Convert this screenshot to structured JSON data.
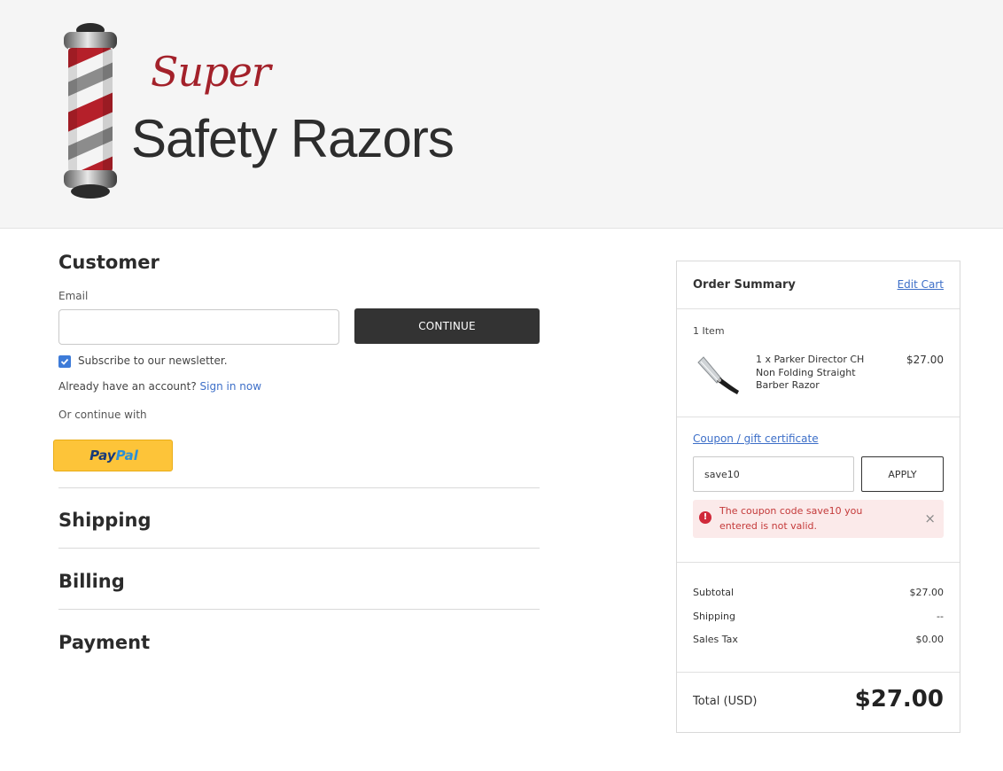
{
  "header": {
    "logo": {
      "word_super": "Super",
      "word_main": "Safety Razors"
    }
  },
  "checkout": {
    "customer": {
      "title": "Customer",
      "email_label": "Email",
      "email_value": "",
      "continue_label": "CONTINUE",
      "subscribe_label": "Subscribe to our newsletter.",
      "subscribe_checked": true,
      "account_prompt": "Already have an account?",
      "signin_label": "Sign in now",
      "continue_with": "Or continue with",
      "paypal_label_1": "Pay",
      "paypal_label_2": "Pal"
    },
    "sections": {
      "shipping": "Shipping",
      "billing": "Billing",
      "payment": "Payment"
    }
  },
  "summary": {
    "title": "Order Summary",
    "edit_cart": "Edit Cart",
    "item_count": "1 Item",
    "item": {
      "name": "1 x Parker Director CH Non Folding Straight Barber Razor",
      "price": "$27.00"
    },
    "coupon": {
      "link_label": "Coupon / gift certificate",
      "value": "save10",
      "apply_label": "APPLY",
      "error_text": "The coupon code save10 you entered is not valid.",
      "error_icon": "!",
      "close_icon": "×"
    },
    "totals": {
      "subtotal_label": "Subtotal",
      "subtotal_value": "$27.00",
      "shipping_label": "Shipping",
      "shipping_value": "--",
      "tax_label": "Sales Tax",
      "tax_value": "$0.00",
      "total_label": "Total (USD)",
      "total_value": "$27.00"
    }
  },
  "colors": {
    "link": "#3d6fc8",
    "brand_red": "#a3212a",
    "error": "#c43a3a",
    "paypal_yellow": "#fdc439"
  }
}
